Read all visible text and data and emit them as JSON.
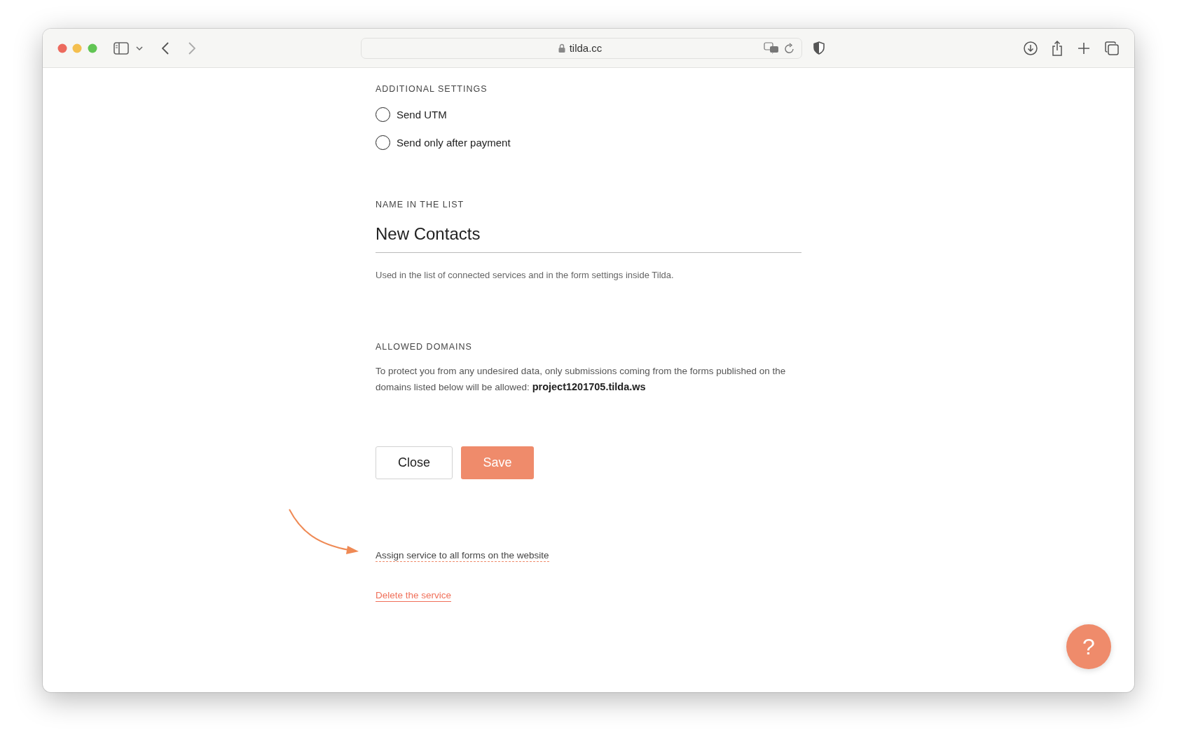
{
  "browser": {
    "url": "tilda.cc"
  },
  "additional_settings": {
    "heading": "ADDITIONAL SETTINGS",
    "options": [
      {
        "label": "Send UTM",
        "checked": false
      },
      {
        "label": "Send only after payment",
        "checked": false
      }
    ]
  },
  "name_in_list": {
    "heading": "NAME IN THE LIST",
    "value": "New Contacts",
    "hint": "Used in the list of connected services and in the form settings inside Tilda."
  },
  "allowed_domains": {
    "heading": "ALLOWED DOMAINS",
    "text": "To protect you from any undesired data, only submissions coming from the forms published on the domains listed below will be allowed: **project1201705.tilda.ws**"
  },
  "buttons": [
    {
      "label": "Close",
      "kind": "secondary"
    },
    {
      "label": "Save",
      "kind": "primary"
    }
  ],
  "links": [
    {
      "label": "Assign service to all forms on the website",
      "kind": "assign"
    },
    {
      "label": "Delete the service",
      "kind": "delete"
    }
  ],
  "help_button": {
    "label": "?"
  }
}
